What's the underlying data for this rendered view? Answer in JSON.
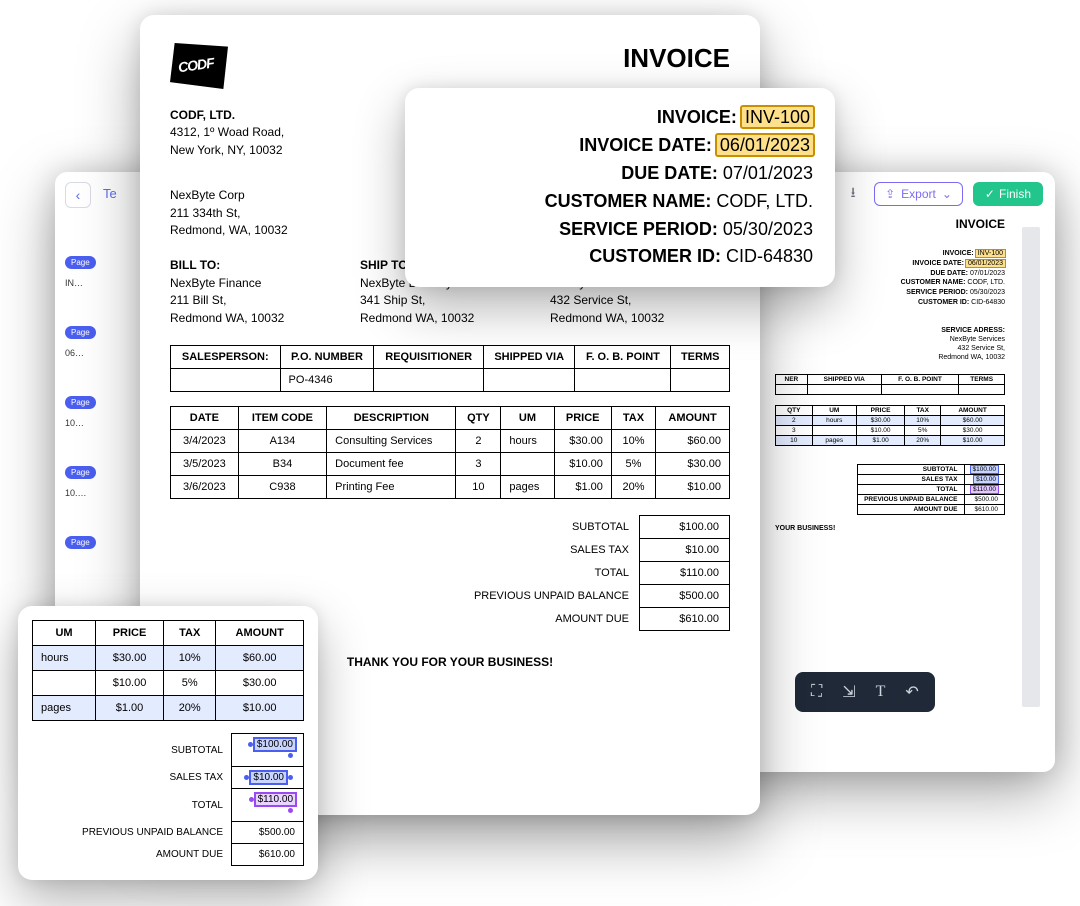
{
  "invoice": {
    "title": "INVOICE",
    "company": {
      "name": "CODF, LTD.",
      "addr1": "4312, 1º Woad Road,",
      "addr2": "New York, NY, 10032"
    },
    "logo_text": "CODF",
    "customer_block": {
      "name": "NexByte Corp",
      "addr1": "211 334th St,",
      "addr2": "Redmond, WA, 10032"
    },
    "bill_to": {
      "label": "BILL TO:",
      "name": "NexByte Finance",
      "addr1": "211 Bill St,",
      "addr2": "Redmond WA, 10032"
    },
    "ship_to": {
      "label": "SHIP TO:",
      "name": "NexByte Delivery",
      "addr1": "341 Ship St,",
      "addr2": "Redmond WA, 10032"
    },
    "service_addr": {
      "label": "SERVICE ADRESS:",
      "name": "NexByte Services",
      "addr1": "432 Service St,",
      "addr2": "Redmond WA, 10032"
    },
    "grid1_headers": {
      "salesperson": "SALESPERSON:",
      "po": "P.O. NUMBER",
      "req": "REQUISITIONER",
      "ship": "SHIPPED VIA",
      "fob": "F. O. B. POINT",
      "terms": "TERMS"
    },
    "grid1_values": {
      "po": "PO-4346"
    },
    "grid2_headers": {
      "date": "DATE",
      "item": "ITEM CODE",
      "desc": "DESCRIPTION",
      "qty": "QTY",
      "um": "UM",
      "price": "PRICE",
      "tax": "TAX",
      "amount": "AMOUNT"
    },
    "lines": [
      {
        "date": "3/4/2023",
        "code": "A134",
        "desc": "Consulting Services",
        "qty": "2",
        "um": "hours",
        "price": "$30.00",
        "tax": "10%",
        "amount": "$60.00"
      },
      {
        "date": "3/5/2023",
        "code": "B34",
        "desc": "Document fee",
        "qty": "3",
        "um": "",
        "price": "$10.00",
        "tax": "5%",
        "amount": "$30.00"
      },
      {
        "date": "3/6/2023",
        "code": "C938",
        "desc": "Printing Fee",
        "qty": "10",
        "um": "pages",
        "price": "$1.00",
        "tax": "20%",
        "amount": "$10.00"
      }
    ],
    "totals": {
      "subtotal_lbl": "SUBTOTAL",
      "subtotal": "$100.00",
      "tax_lbl": "SALES TAX",
      "tax": "$10.00",
      "total_lbl": "TOTAL",
      "total": "$110.00",
      "prev_lbl": "PREVIOUS UNPAID BALANCE",
      "prev": "$500.00",
      "due_lbl": "AMOUNT DUE",
      "due": "$610.00"
    },
    "thanks": "THANK YOU FOR YOUR BUSINESS!"
  },
  "callout": {
    "rows": [
      {
        "label": "INVOICE:",
        "value": "INV-100",
        "hl": true
      },
      {
        "label": "INVOICE DATE:",
        "value": "06/01/2023",
        "hl": true
      },
      {
        "label": "DUE DATE:",
        "value": "07/01/2023",
        "hl": false
      },
      {
        "label": "CUSTOMER NAME:",
        "value": "CODF, LTD.",
        "hl": false
      },
      {
        "label": "SERVICE PERIOD:",
        "value": "05/30/2023",
        "hl": false
      },
      {
        "label": "CUSTOMER ID:",
        "value": "CID-64830",
        "hl": false
      }
    ]
  },
  "callout2": {
    "headers": {
      "um": "UM",
      "price": "PRICE",
      "tax": "TAX",
      "amount": "AMOUNT"
    },
    "rows": [
      {
        "um": "hours",
        "price": "$30.00",
        "tax": "10%",
        "amount": "$60.00",
        "hl": true
      },
      {
        "um": "",
        "price": "$10.00",
        "tax": "5%",
        "amount": "$30.00",
        "hl": false
      },
      {
        "um": "pages",
        "price": "$1.00",
        "tax": "20%",
        "amount": "$10.00",
        "hl": true
      }
    ],
    "totals": {
      "subtotal_lbl": "SUBTOTAL",
      "subtotal": "$100.00",
      "tax_lbl": "SALES TAX",
      "tax": "$10.00",
      "total_lbl": "TOTAL",
      "total": "$110.00",
      "prev_lbl": "PREVIOUS UNPAID BALANCE",
      "prev": "$500.00",
      "due_lbl": "AMOUNT DUE",
      "due": "$610.00"
    }
  },
  "app": {
    "te": "Te",
    "export": "Export",
    "finish": "Finish",
    "page_pill": "Page",
    "pill_vals": [
      "IN…",
      "06…",
      "10…",
      "10.…"
    ],
    "doc_title": "INVOICE",
    "meta": [
      {
        "label": "INVOICE:",
        "value": "INV-100",
        "hl": "y"
      },
      {
        "label": "INVOICE DATE:",
        "value": "06/01/2023",
        "hl": "y"
      },
      {
        "label": "DUE DATE:",
        "value": "07/01/2023",
        "hl": ""
      },
      {
        "label": "CUSTOMER NAME:",
        "value": "CODF, LTD.",
        "hl": ""
      },
      {
        "label": "SERVICE PERIOD:",
        "value": "05/30/2023",
        "hl": ""
      },
      {
        "label": "CUSTOMER ID:",
        "value": "CID-64830",
        "hl": ""
      }
    ],
    "service_addr": {
      "label": "SERVICE ADRESS:",
      "name": "NexByte Services",
      "addr1": "432 Service St,",
      "addr2": "Redmond WA, 10032"
    },
    "t1_headers": {
      "ner": "NER",
      "ship": "SHIPPED VIA",
      "fob": "F. O. B. POINT",
      "terms": "TERMS"
    },
    "t2_headers": {
      "qty": "QTY",
      "um": "UM",
      "price": "PRICE",
      "tax": "TAX",
      "amount": "AMOUNT"
    },
    "t2_rows": [
      {
        "qty": "2",
        "um": "hours",
        "price": "$30.00",
        "tax": "10%",
        "amount": "$60.00"
      },
      {
        "qty": "3",
        "um": "",
        "price": "$10.00",
        "tax": "5%",
        "amount": "$30.00"
      },
      {
        "qty": "10",
        "um": "pages",
        "price": "$1.00",
        "tax": "20%",
        "amount": "$10.00"
      }
    ],
    "totals": {
      "subtotal_lbl": "SUBTOTAL",
      "subtotal": "$100.00",
      "tax_lbl": "SALES TAX",
      "tax": "$10.00",
      "total_lbl": "TOTAL",
      "total": "$110.00",
      "prev_lbl": "PREVIOUS UNPAID BALANCE",
      "prev": "$500.00",
      "due_lbl": "AMOUNT DUE",
      "due": "$610.00"
    },
    "thanks": "YOUR BUSINESS!",
    "ery": "ery",
    "zero": "10032"
  }
}
